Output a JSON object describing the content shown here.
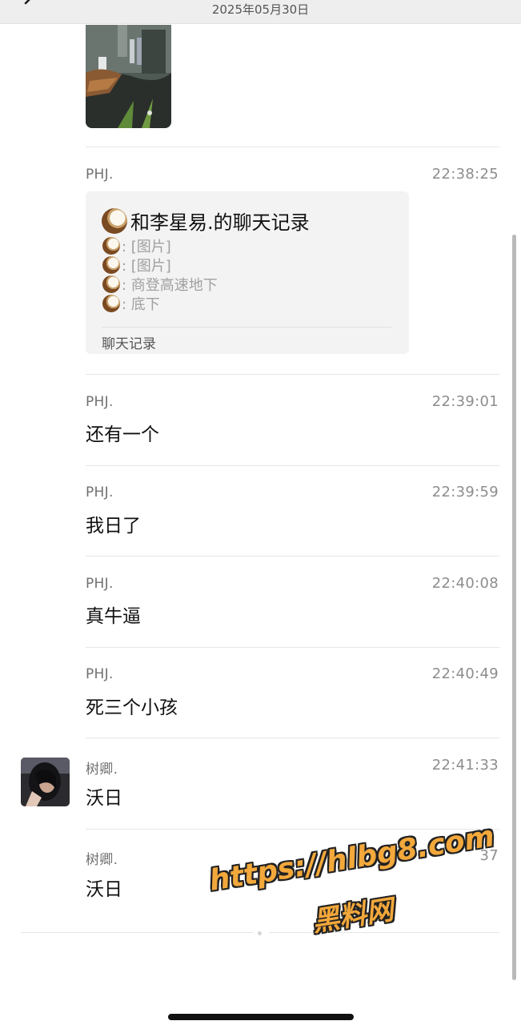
{
  "header": {
    "date": "2025年05月30日",
    "back_icon": "chevron-left-icon"
  },
  "image_message": {
    "icon": "photo-thumbnail"
  },
  "forwarded_record": {
    "sender": "PHJ.",
    "time": "22:38:25",
    "title": "和李星易.的聊天记录",
    "lines": [
      {
        "text": ": [图片]"
      },
      {
        "text": ": [图片]"
      },
      {
        "text": ": 商登高速地下"
      },
      {
        "text": ": 底下"
      }
    ],
    "label": "聊天记录"
  },
  "messages": [
    {
      "sender": "PHJ.",
      "time": "22:39:01",
      "text": "还有一个"
    },
    {
      "sender": "PHJ.",
      "time": "22:39:59",
      "text": "我日了"
    },
    {
      "sender": "PHJ.",
      "time": "22:40:08",
      "text": "真牛逼"
    },
    {
      "sender": "PHJ.",
      "time": "22:40:49",
      "text": "死三个小孩"
    },
    {
      "sender": "树卿.",
      "time": "22:41:33",
      "text": "沃日"
    },
    {
      "sender": "树卿.",
      "time": "37",
      "text": "沃日"
    }
  ],
  "watermark": {
    "url": "https://hlbg8.com",
    "name": "黑料网",
    "color": "#f3a83b"
  }
}
